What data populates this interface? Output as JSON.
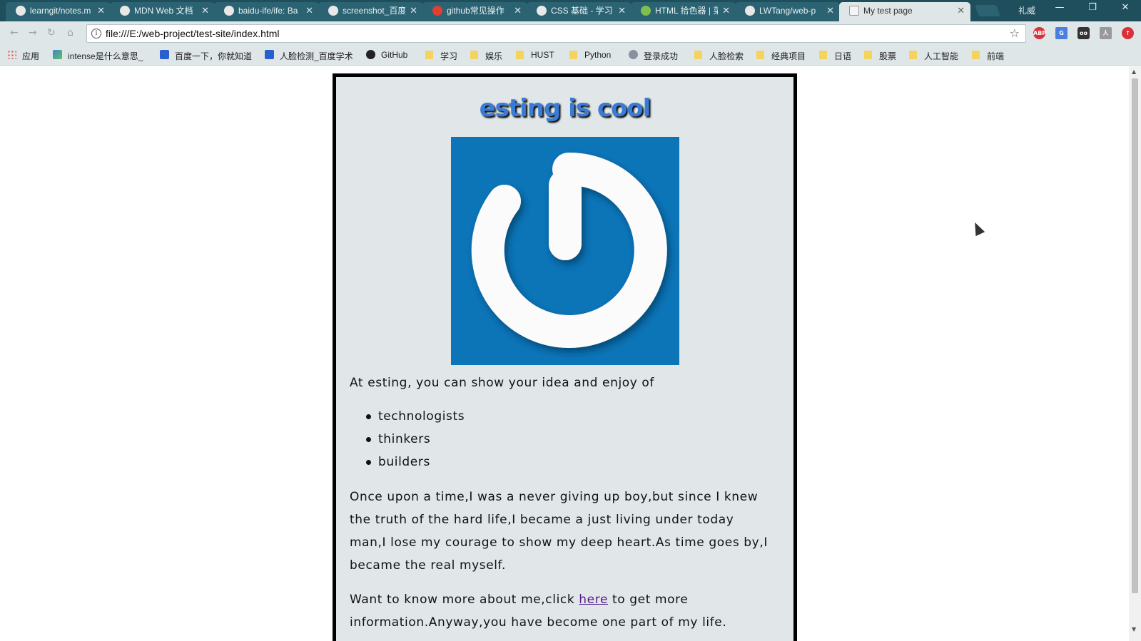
{
  "browser": {
    "tabs": [
      {
        "label": "learngit/notes.m",
        "icon": "github-icon"
      },
      {
        "label": "MDN Web 文档",
        "icon": "mdn-icon"
      },
      {
        "label": "baidu-ife/ife: Ba",
        "icon": "github-icon"
      },
      {
        "label": "screenshot_百度",
        "icon": "baidu-icon"
      },
      {
        "label": "github常见操作",
        "icon": "csdn-icon"
      },
      {
        "label": "CSS 基础 - 学习",
        "icon": "mdn-icon"
      },
      {
        "label": "HTML 拾色器 | 菜",
        "icon": "runoob-icon"
      },
      {
        "label": "LWTang/web-p",
        "icon": "github-icon"
      },
      {
        "label": "My test page",
        "icon": "page-icon"
      }
    ],
    "active_tab_index": 8,
    "profile_name": "礼威",
    "address": "file:///E:/web-project/test-site/index.html",
    "bookmarks": [
      {
        "label": "应用",
        "icon": "apps-icon"
      },
      {
        "label": "intense是什么意思_",
        "icon": "image-icon"
      },
      {
        "label": "百度一下，你就知道",
        "icon": "baidu-icon"
      },
      {
        "label": "人脸检测_百度学术",
        "icon": "baidu-icon"
      },
      {
        "label": "GitHub",
        "icon": "github-icon"
      },
      {
        "label": "学习",
        "icon": "folder-icon"
      },
      {
        "label": "娱乐",
        "icon": "folder-icon"
      },
      {
        "label": "HUST",
        "icon": "folder-icon"
      },
      {
        "label": "Python",
        "icon": "folder-icon"
      },
      {
        "label": "登录成功",
        "icon": "globe-icon"
      },
      {
        "label": "人脸检索",
        "icon": "folder-icon"
      },
      {
        "label": "经典项目",
        "icon": "folder-icon"
      },
      {
        "label": "日语",
        "icon": "folder-icon"
      },
      {
        "label": "股票",
        "icon": "folder-icon"
      },
      {
        "label": "人工智能",
        "icon": "folder-icon"
      },
      {
        "label": "前端",
        "icon": "folder-icon"
      }
    ],
    "extensions": [
      {
        "name": "adblock-icon",
        "label": "ABP",
        "color": "#d9303a"
      },
      {
        "name": "translate-icon",
        "label": "G",
        "color": "#4a7fe0"
      },
      {
        "name": "glasses-icon",
        "label": "oo",
        "color": "#333333"
      },
      {
        "name": "pdf-icon",
        "label": "人",
        "color": "#999999"
      },
      {
        "name": "upload-icon",
        "label": "↑",
        "color": "#d9303a"
      }
    ]
  },
  "page": {
    "title": "esting is cool",
    "intro": "At esting, you can show your idea and enjoy of",
    "list": [
      "technologists",
      "thinkers",
      "builders"
    ],
    "story": "Once upon a time,I was a never giving up boy,but since I knew the truth of the hard life,I became a just living under today man,I lose my courage to show my deep heart.As time goes by,I became the real myself.",
    "more_before": "Want to know more about me,click ",
    "more_link": "here",
    "more_after": " to get more information.Anyway,you have become one part of my life."
  },
  "colors": {
    "tabstrip": "#1f4e5c",
    "card_background": "#e1e7e8",
    "logo_background": "#0b75b8",
    "title": "#3a7bd5",
    "visited_link": "#551a8b"
  }
}
